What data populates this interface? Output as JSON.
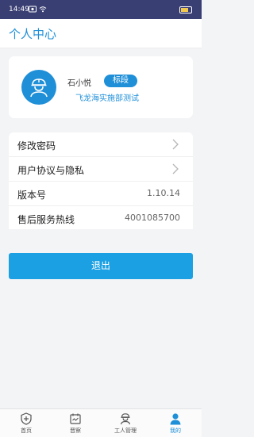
{
  "status_bar": {
    "time": "14:49"
  },
  "header": {
    "title": "个人中心"
  },
  "profile": {
    "name": "石小悦",
    "role_badge": "标段",
    "project": "飞龙海实施部测试"
  },
  "settings": {
    "change_password": "修改密码",
    "agreement_privacy": "用户协议与隐私",
    "version_label": "版本号",
    "version_value": "1.10.14",
    "hotline_label": "售后服务热线",
    "hotline_value": "4001085700"
  },
  "logout_label": "退出",
  "tabs": [
    {
      "label": "首页",
      "icon": "shield-icon"
    },
    {
      "label": "晋察",
      "icon": "calendar-icon"
    },
    {
      "label": "工人管理",
      "icon": "worker-icon"
    },
    {
      "label": "我的",
      "icon": "person-icon"
    }
  ],
  "colors": {
    "status_bar": "#3a3f73",
    "accent": "#1f8fd8",
    "logout_button": "#1aa0e3",
    "page_background": "#f3f4f6"
  }
}
